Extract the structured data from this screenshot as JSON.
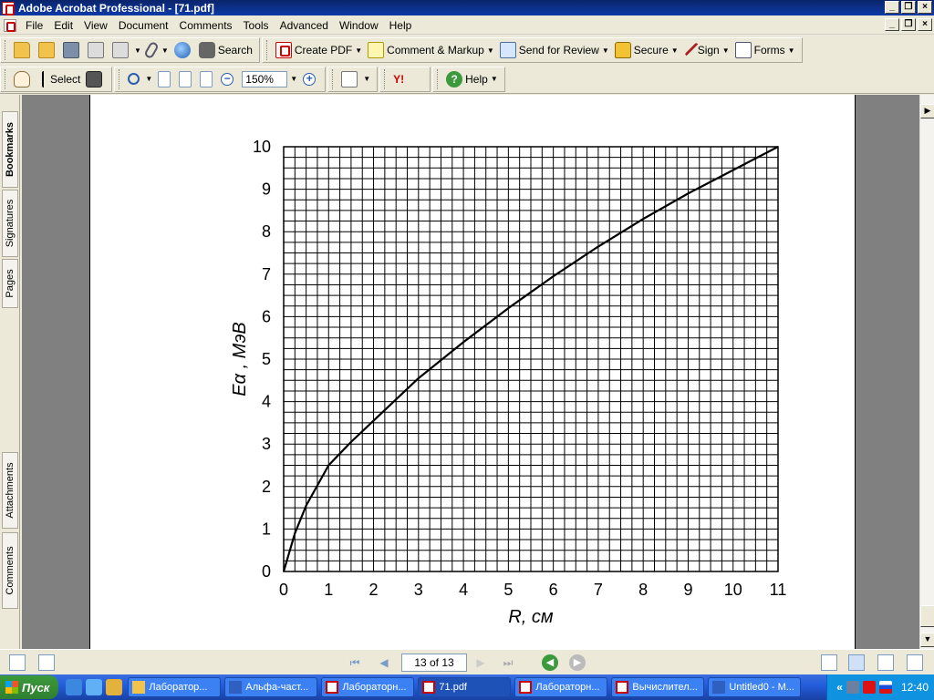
{
  "window": {
    "title": "Adobe Acrobat Professional - [71.pdf]",
    "buttons": [
      "_",
      "❐",
      "×"
    ]
  },
  "menu": {
    "items": [
      "File",
      "Edit",
      "View",
      "Document",
      "Comments",
      "Tools",
      "Advanced",
      "Window",
      "Help"
    ]
  },
  "toolbar1": {
    "search_label": "Search",
    "create_pdf_label": "Create PDF",
    "comment_markup_label": "Comment & Markup",
    "send_review_label": "Send for Review",
    "secure_label": "Secure",
    "sign_label": "Sign",
    "forms_label": "Forms"
  },
  "toolbar2": {
    "select_label": "Select",
    "zoom_value": "150%",
    "yahoo_label": "Y!",
    "help_label": "Help"
  },
  "nav_panel": {
    "tabs": [
      "Bookmarks",
      "Signatures",
      "Pages",
      "Attachments",
      "Comments"
    ]
  },
  "statusbar": {
    "page_value": "13 of 13"
  },
  "taskbar": {
    "start_label": "Пуск",
    "tasks": [
      "Лаборатор...",
      "Альфа-част...",
      "Лабораторн...",
      "71.pdf",
      "Лабораторн...",
      "Вычислител...",
      "Untitled0 - M..."
    ],
    "active_task": 3,
    "clock": "12:40",
    "tray_chevron": "«"
  },
  "chart_data": {
    "type": "line",
    "xlabel": "R, см",
    "ylabel": "Eα , МэВ",
    "xlim": [
      0,
      11
    ],
    "ylim": [
      0,
      10
    ],
    "x_ticks": [
      0,
      1,
      2,
      3,
      4,
      5,
      6,
      7,
      8,
      9,
      10,
      11
    ],
    "y_ticks": [
      0,
      1,
      2,
      3,
      4,
      5,
      6,
      7,
      8,
      9,
      10
    ],
    "grid": true,
    "series": [
      {
        "x": [
          0,
          0.25,
          0.5,
          1,
          1.5,
          2,
          3,
          4,
          5,
          6,
          7,
          8,
          9,
          10,
          11
        ],
        "y": [
          0,
          0.9,
          1.55,
          2.5,
          3.05,
          3.55,
          4.55,
          5.4,
          6.2,
          6.95,
          7.65,
          8.3,
          8.9,
          9.45,
          10.0
        ]
      }
    ]
  }
}
